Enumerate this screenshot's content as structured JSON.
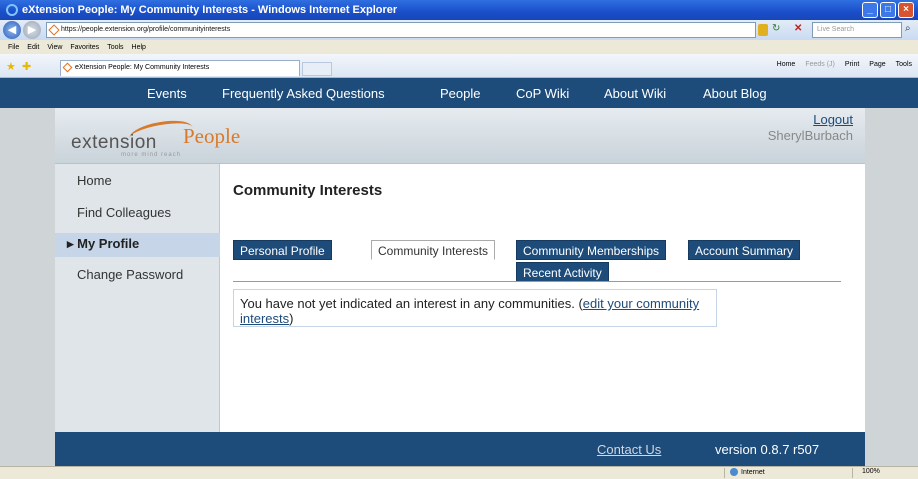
{
  "window": {
    "title": "eXtension People: My Community Interests - Windows Internet Explorer"
  },
  "address": {
    "url": "https://people.extension.org/profile/communityinterests",
    "search_placeholder": "Live Search"
  },
  "menu": [
    "File",
    "Edit",
    "View",
    "Favorites",
    "Tools",
    "Help"
  ],
  "tab": {
    "label": "eXtension People: My Community Interests"
  },
  "commandbar": {
    "home": "Home",
    "feeds": "Feeds (J)",
    "print": "Print",
    "page": "Page",
    "tools": "Tools"
  },
  "topnav": [
    "Events",
    "Frequently Asked Questions",
    "People",
    "CoP Wiki",
    "About Wiki",
    "About Blog"
  ],
  "header": {
    "logo_text": "extension",
    "logo_tagline": "more mind reach",
    "logo_people": "People",
    "logout": "Logout",
    "username": "SherylBurbach"
  },
  "sidebar": {
    "items": [
      {
        "label": "Home",
        "active": false
      },
      {
        "label": "Find Colleagues",
        "active": false
      },
      {
        "label": "▸ My Profile",
        "active": true
      },
      {
        "label": "Change Password",
        "active": false
      }
    ]
  },
  "main": {
    "title": "Community Interests",
    "tabs": [
      {
        "label": "Personal Profile",
        "current": false
      },
      {
        "label": "Community Interests",
        "current": true
      },
      {
        "label": "Community Memberships",
        "current": false
      },
      {
        "label": "Account Summary",
        "current": false
      },
      {
        "label": "Recent Activity",
        "current": false
      }
    ],
    "notice_text": "You have not yet indicated an interest in any communities. (",
    "notice_link": "edit your community interests",
    "notice_end": ")"
  },
  "footer": {
    "contact": "Contact Us",
    "version": "version 0.8.7 r507"
  },
  "status": {
    "zone": "Internet",
    "zoom": "100%"
  },
  "colors": {
    "brand_blue": "#1d4b7a",
    "brand_orange": "#d87a2a"
  }
}
